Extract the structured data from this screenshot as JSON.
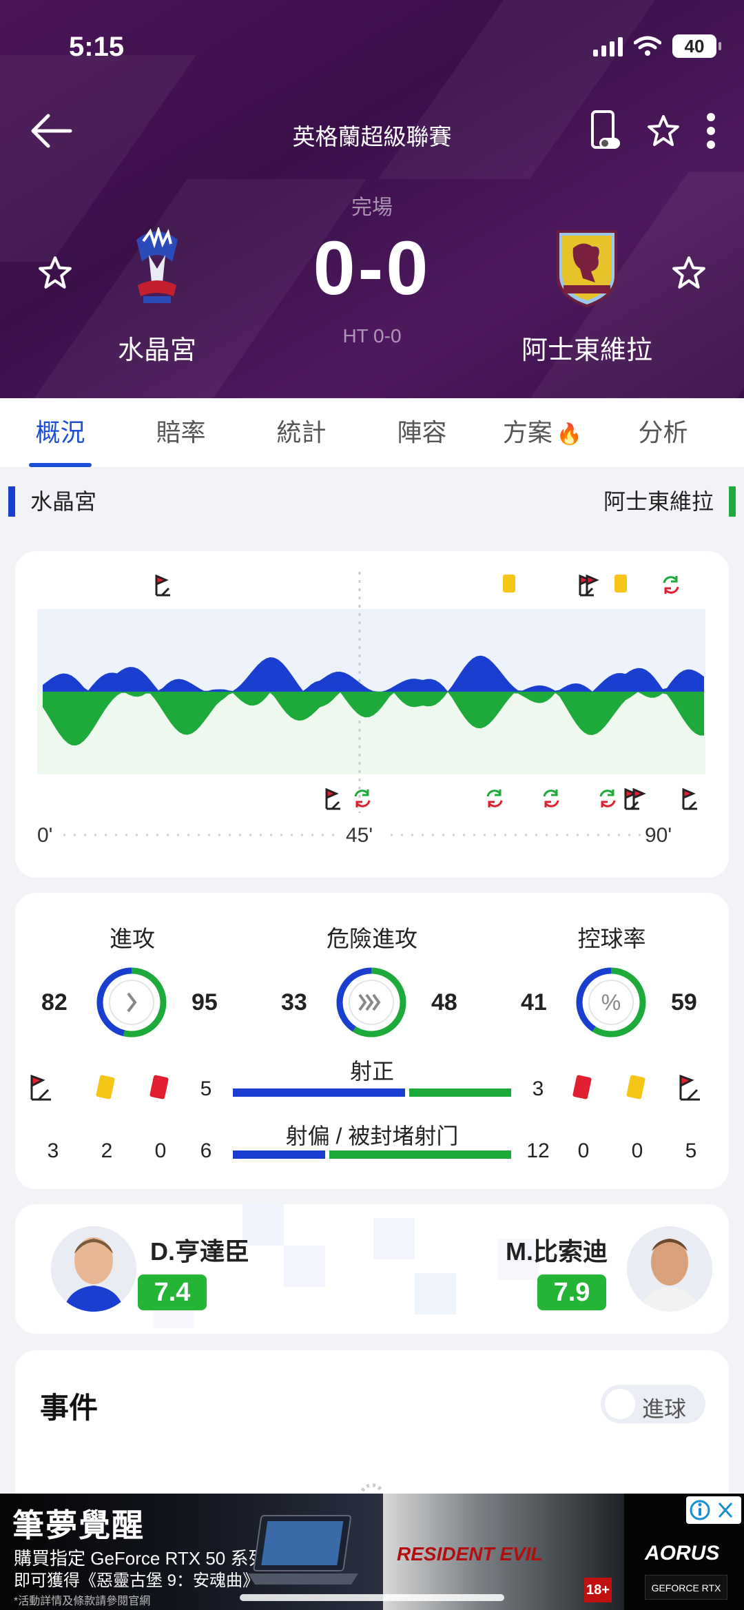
{
  "status_bar": {
    "time": "5:15",
    "battery": "40"
  },
  "header": {
    "league": "英格蘭超級聯賽",
    "match_status": "完場",
    "score": "0-0",
    "halftime": "HT 0-0",
    "home_team": "水晶宮",
    "away_team": "阿士東維拉"
  },
  "tabs": [
    "概況",
    "賠率",
    "統計",
    "陣容",
    "方案",
    "分析"
  ],
  "team_bar": {
    "home": "水晶宮",
    "away": "阿士東維拉"
  },
  "momentum": {
    "time_labels": [
      "0'",
      "45'",
      "90'"
    ],
    "colors": {
      "home": "#1a3fd0",
      "away": "#1daa3a"
    }
  },
  "stats": {
    "attacks": {
      "label": "進攻",
      "home": "82",
      "away": "95"
    },
    "dangerous_attacks": {
      "label": "危險進攻",
      "home": "33",
      "away": "48"
    },
    "possession": {
      "label": "控球率",
      "home": "41",
      "away": "59"
    },
    "shots_on_target": {
      "label": "射正",
      "home": "5",
      "away": "3"
    },
    "shots_off_blocked": {
      "label": "射偏 / 被封堵射门",
      "home": "6",
      "away": "12"
    },
    "home_corners": "3",
    "home_yellow": "2",
    "home_red": "0",
    "away_red": "0",
    "away_yellow": "0",
    "away_corners": "5"
  },
  "players": {
    "home": {
      "name": "D.亨達臣",
      "rating": "7.4"
    },
    "away": {
      "name": "M.比索迪",
      "rating": "7.9"
    }
  },
  "events": {
    "title": "事件",
    "toggle_label": "進球"
  },
  "ad": {
    "title": "筆夢覺醒",
    "line1": "購買指定 GeForce RTX 50 系列",
    "line2": "即可獲得《惡靈古堡 9：安魂曲》",
    "line3": "*活動詳情及條款請參閱官網",
    "game": "RESIDENT EVIL",
    "brand": "AORUS",
    "badge": "18+",
    "nvidia": "GEFORCE RTX"
  }
}
